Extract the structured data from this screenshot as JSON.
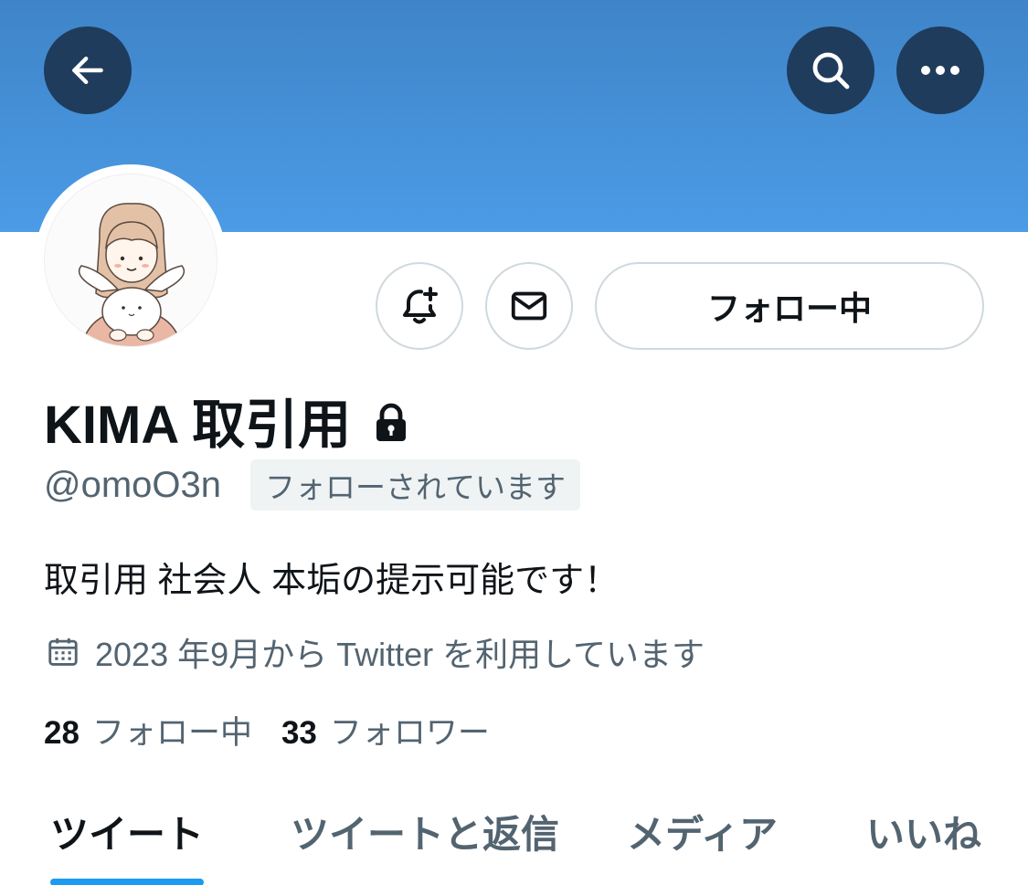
{
  "header": {
    "back_icon": "arrow-left-icon",
    "search_icon": "search-icon",
    "more_icon": "more-horizontal-icon",
    "banner_color": "#4b9be6"
  },
  "profile": {
    "display_name": "KIMA 取引用",
    "protected_icon": "lock-icon",
    "handle": "@omoO3n",
    "follows_you_label": "フォローされています",
    "bio": "取引用 社会人 本垢の提示可能です！",
    "joined_icon": "calendar-icon",
    "joined_text": "2023 年9月から Twitter を利用しています",
    "following_count": "28",
    "following_label": "フォロー中",
    "followers_count": "33",
    "followers_label": "フォロワー"
  },
  "actions": {
    "notify_icon": "bell-plus-icon",
    "dm_icon": "envelope-icon",
    "follow_button_label": "フォロー中"
  },
  "tabs": [
    {
      "label": "ツイート",
      "active": true
    },
    {
      "label": "ツイートと返信",
      "active": false
    },
    {
      "label": "メディア",
      "active": false
    },
    {
      "label": "いいね",
      "active": false
    }
  ],
  "colors": {
    "accent": "#1d9bf0",
    "nav_button_bg": "#1f3c5c",
    "secondary_text": "#536471"
  }
}
